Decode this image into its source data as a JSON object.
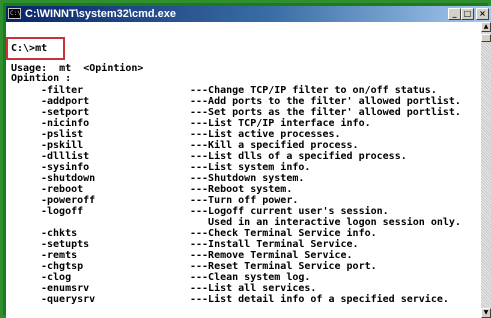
{
  "window": {
    "title": "C:\\WINNT\\system32\\cmd.exe",
    "icon": "cmd-icon",
    "buttons": {
      "minimize": "_",
      "maximize": "□",
      "close": "×"
    }
  },
  "console": {
    "prompt": "C:\\>mt",
    "usage": "Usage:  mt  <Opintion>",
    "options_header": "Opintion :",
    "options": [
      {
        "flag": "-filter",
        "desc": "---Change TCP/IP filter to on/off status."
      },
      {
        "flag": "-addport",
        "desc": "---Add ports to the filter' allowed portlist."
      },
      {
        "flag": "-setport",
        "desc": "---Set ports as the filter' allowed portlist."
      },
      {
        "flag": "-nicinfo",
        "desc": "---List TCP/IP interface info."
      },
      {
        "flag": "-pslist",
        "desc": "---List active processes."
      },
      {
        "flag": "-pskill",
        "desc": "---Kill a specified process."
      },
      {
        "flag": "-dlllist",
        "desc": "---List dlls of a specified process."
      },
      {
        "flag": "-sysinfo",
        "desc": "---List system info."
      },
      {
        "flag": "-shutdown",
        "desc": "---Shutdown system."
      },
      {
        "flag": "-reboot",
        "desc": "---Reboot system."
      },
      {
        "flag": "-poweroff",
        "desc": "---Turn off power."
      },
      {
        "flag": "-logoff",
        "desc": "---Logoff current user's session."
      },
      {
        "flag": "",
        "desc": "   Used in an interactive logon session only."
      },
      {
        "flag": "-chkts",
        "desc": "---Check Terminal Service info."
      },
      {
        "flag": "-setupts",
        "desc": "---Install Terminal Service."
      },
      {
        "flag": "-remts",
        "desc": "---Remove Terminal Service."
      },
      {
        "flag": "-chgtsp",
        "desc": "---Reset Terminal Service port."
      },
      {
        "flag": "-clog",
        "desc": "---Clean system log."
      },
      {
        "flag": "-enumsrv",
        "desc": "---List all services."
      },
      {
        "flag": "-querysrv",
        "desc": "---List detail info of a specified service."
      }
    ]
  },
  "colors": {
    "titlebar_start": "#0a246a",
    "titlebar_end": "#a6caf0",
    "console_bg": "#ffffff",
    "console_text": "#000000",
    "highlight": "#c8323c",
    "frame": "#1e7a1e"
  }
}
